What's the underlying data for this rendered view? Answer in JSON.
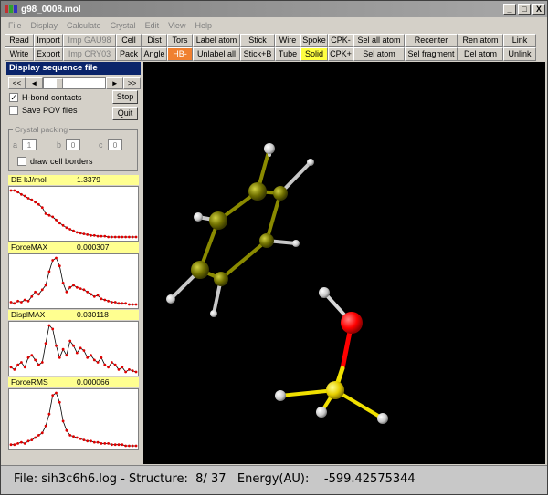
{
  "window": {
    "title": "g98_0008.mol"
  },
  "window_buttons": [
    "_",
    "□",
    "X"
  ],
  "menu": [
    "File",
    "Display",
    "Calculate",
    "Crystal",
    "Edit",
    "View",
    "Help"
  ],
  "toolbar": {
    "row1": [
      {
        "label": "Read",
        "w": 32
      },
      {
        "label": "Import",
        "w": 32
      },
      {
        "label": "Imp GAU98",
        "w": 58,
        "disabled": true
      },
      {
        "label": "Cell",
        "w": 28
      },
      {
        "label": "Dist",
        "w": 28
      },
      {
        "label": "Tors",
        "w": 28
      },
      {
        "label": "Label atom",
        "w": 52
      },
      {
        "label": "Stick",
        "w": 38
      },
      {
        "label": "Wire",
        "w": 28
      },
      {
        "label": "Spoke",
        "w": 30
      },
      {
        "label": "CPK-",
        "w": 28
      },
      {
        "label": "Sel all atom",
        "w": 56
      },
      {
        "label": "Recenter",
        "w": 58
      },
      {
        "label": "Ren atom",
        "w": 50
      },
      {
        "label": "Link",
        "w": 36
      }
    ],
    "row2": [
      {
        "label": "Write",
        "w": 32
      },
      {
        "label": "Export",
        "w": 32
      },
      {
        "label": "Imp CRY03",
        "w": 58,
        "disabled": true
      },
      {
        "label": "Pack",
        "w": 28
      },
      {
        "label": "Angle",
        "w": 28
      },
      {
        "label": "HB-",
        "w": 28,
        "style": "hb"
      },
      {
        "label": "Unlabel all",
        "w": 52
      },
      {
        "label": "Stick+B",
        "w": 38
      },
      {
        "label": "Tube",
        "w": 28
      },
      {
        "label": "Solid",
        "w": 30,
        "style": "solid"
      },
      {
        "label": "CPK+",
        "w": 28
      },
      {
        "label": "Sel atom",
        "w": 56
      },
      {
        "label": "Sel fragment",
        "w": 58
      },
      {
        "label": "Del atom",
        "w": 50
      },
      {
        "label": "Unlink",
        "w": 36
      }
    ]
  },
  "panel": {
    "title": "Display sequence file",
    "nav": {
      "first": "<<",
      "prev": "◄",
      "next": "►",
      "last": ">>"
    },
    "progress": 0.22,
    "hbond_label": "H-bond contacts",
    "hbond_checked": "✓",
    "pov_label": "Save POV files",
    "pov_checked": "",
    "stop_label": "Stop",
    "quit_label": "Quit",
    "crystal": {
      "title": "Crystal packing",
      "a_label": "a",
      "a_value": "1",
      "b_label": "b",
      "b_value": "0",
      "c_label": "c",
      "c_value": "0",
      "cell_borders_label": "draw cell borders",
      "cell_borders_checked": ""
    }
  },
  "metrics": [
    {
      "label": "DE  kJ/mol",
      "value": "1.3379"
    },
    {
      "label": "ForceMAX",
      "value": "0.000307"
    },
    {
      "label": "DisplMAX",
      "value": "0.030118"
    },
    {
      "label": "ForceRMS",
      "value": "0.000066"
    }
  ],
  "chart_data": [
    {
      "type": "line",
      "name": "DE kJ/mol",
      "values": [
        60,
        60,
        58,
        55,
        53,
        50,
        48,
        45,
        42,
        38,
        30,
        28,
        26,
        22,
        18,
        15,
        12,
        10,
        8,
        6,
        5,
        4,
        3,
        2,
        2,
        1,
        1,
        1,
        0,
        0,
        0,
        0,
        0,
        0,
        0,
        0,
        0
      ]
    },
    {
      "type": "line",
      "name": "ForceMAX",
      "values": [
        3,
        2,
        4,
        3,
        5,
        4,
        8,
        12,
        10,
        14,
        18,
        30,
        40,
        42,
        35,
        20,
        12,
        16,
        18,
        16,
        15,
        14,
        12,
        10,
        8,
        9,
        6,
        5,
        4,
        3,
        3,
        2,
        2,
        2,
        1,
        1,
        1
      ]
    },
    {
      "type": "line",
      "name": "DisplMAX",
      "values": [
        10,
        8,
        12,
        14,
        10,
        18,
        20,
        16,
        12,
        14,
        30,
        45,
        42,
        28,
        18,
        25,
        20,
        32,
        28,
        22,
        26,
        24,
        18,
        20,
        16,
        14,
        18,
        12,
        10,
        14,
        12,
        8,
        10,
        6,
        8,
        7,
        6
      ]
    },
    {
      "type": "line",
      "name": "ForceRMS",
      "values": [
        2,
        2,
        3,
        4,
        3,
        5,
        6,
        8,
        10,
        12,
        18,
        28,
        44,
        46,
        38,
        22,
        14,
        10,
        9,
        8,
        7,
        6,
        5,
        5,
        4,
        4,
        3,
        3,
        3,
        2,
        2,
        2,
        2,
        1,
        1,
        1,
        1
      ]
    }
  ],
  "status": {
    "file_label": "File:",
    "file": "sih3c6h6.log",
    "structure_label": "- Structure:",
    "structure": "8/ 37",
    "energy_label": "Energy(AU):",
    "energy": "-599.42575344"
  },
  "molecule": {
    "carbon_color": "#8a8a00",
    "hydrogen_color": "#e8e8e8",
    "silicon_color": "#f0e000",
    "oxygen_color": "#ff0000",
    "bond_color": "#b0b0b0"
  }
}
